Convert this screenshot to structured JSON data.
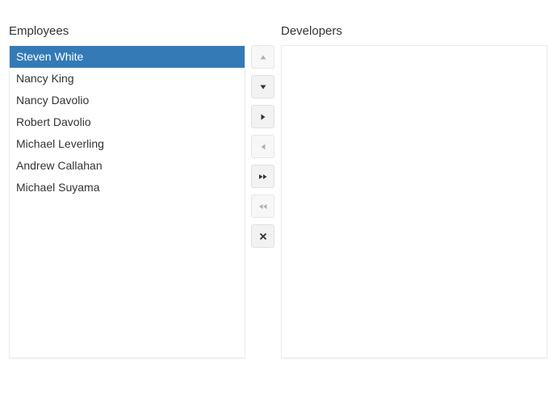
{
  "left_list": {
    "title": "Employees",
    "items": [
      {
        "label": "Steven White",
        "selected": true
      },
      {
        "label": "Nancy King",
        "selected": false
      },
      {
        "label": "Nancy Davolio",
        "selected": false
      },
      {
        "label": "Robert Davolio",
        "selected": false
      },
      {
        "label": "Michael Leverling",
        "selected": false
      },
      {
        "label": "Andrew Callahan",
        "selected": false
      },
      {
        "label": "Michael Suyama",
        "selected": false
      }
    ]
  },
  "right_list": {
    "title": "Developers",
    "items": []
  },
  "toolbar": [
    {
      "name": "move-up-button",
      "icon": "caret-up-icon",
      "enabled": false
    },
    {
      "name": "move-down-button",
      "icon": "caret-down-icon",
      "enabled": true
    },
    {
      "name": "transfer-to-button",
      "icon": "caret-right-icon",
      "enabled": true
    },
    {
      "name": "transfer-from-button",
      "icon": "caret-left-icon",
      "enabled": false
    },
    {
      "name": "transfer-all-to-button",
      "icon": "double-caret-right-icon",
      "enabled": true
    },
    {
      "name": "transfer-all-from-button",
      "icon": "double-caret-left-icon",
      "enabled": false
    },
    {
      "name": "remove-button",
      "icon": "close-icon",
      "enabled": true
    }
  ],
  "colors": {
    "selected_bg": "#337ab7",
    "icon_enabled": "#333333",
    "icon_disabled": "#b0b0b0"
  }
}
